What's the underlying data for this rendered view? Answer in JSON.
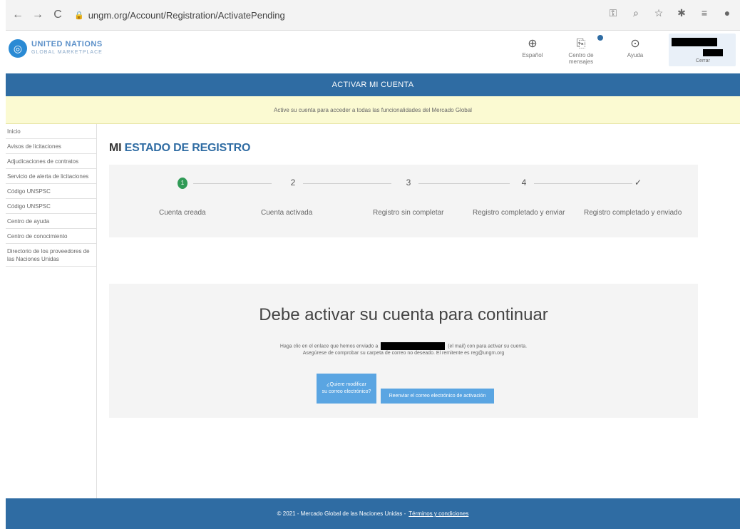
{
  "browser": {
    "url": "ungm.org/Account/Registration/ActivatePending",
    "back_glyph": "←",
    "forward_glyph": "→",
    "reload_glyph": "C"
  },
  "header": {
    "brand_line1": "UNITED NATIONS",
    "brand_line2": "GLOBAL MARKETPLACE",
    "language_label": "Español",
    "notifications_label": "Centro de mensajes",
    "help_label": "Ayuda",
    "user_menu_label": "Cerrar"
  },
  "title_bar": "ACTIVAR MI CUENTA",
  "notice": "Active su cuenta para acceder a todas las funcionalidades del Mercado Global",
  "sidebar": {
    "items": [
      {
        "label": "Inicio"
      },
      {
        "label": "Avisos de licitaciones"
      },
      {
        "label": "Adjudicaciones de contratos"
      },
      {
        "label": "Servicio de alerta de licitaciones"
      },
      {
        "label": "Código UNSPSC"
      },
      {
        "label": "Código UNSPSC"
      },
      {
        "label": "Centro de ayuda"
      },
      {
        "label": "Centro de conocimiento"
      },
      {
        "label": "Directorio de los proveedores de las Naciones Unidas"
      }
    ]
  },
  "page_title_prefix": "MI",
  "page_title": "ESTADO DE REGISTRO",
  "steps": [
    {
      "num": "1",
      "label": "Cuenta creada"
    },
    {
      "num": "2",
      "label": "Cuenta activada"
    },
    {
      "num": "3",
      "label": "Registro sin completar"
    },
    {
      "num": "4",
      "label": "Registro completado y enviar"
    },
    {
      "num": "✓",
      "label": "Registro completado y enviado"
    }
  ],
  "activation": {
    "heading": "Debe activar su cuenta para continuar",
    "line1_prefix": "Haga clic en el enlace que hemos enviado a",
    "line1_suffix": "(el mail) con para activar su cuenta.",
    "line2": "Asegúrese de comprobar su carpeta de correo no deseado. El remitente es reg@ungm.org",
    "modify_btn_line1": "¿Quiere modificar",
    "modify_btn_line2": "su correo electrónico?",
    "resend_btn": "Reenviar el correo electrónico de activación"
  },
  "footer": {
    "text": "© 2021 - Mercado Global de las Naciones Unidas -",
    "link": "Términos y condiciones"
  },
  "colors": {
    "primary": "#2f6ca3",
    "notice_bg": "#fbfad2",
    "button": "#5aa5e2",
    "step_done": "#2f9a56"
  }
}
